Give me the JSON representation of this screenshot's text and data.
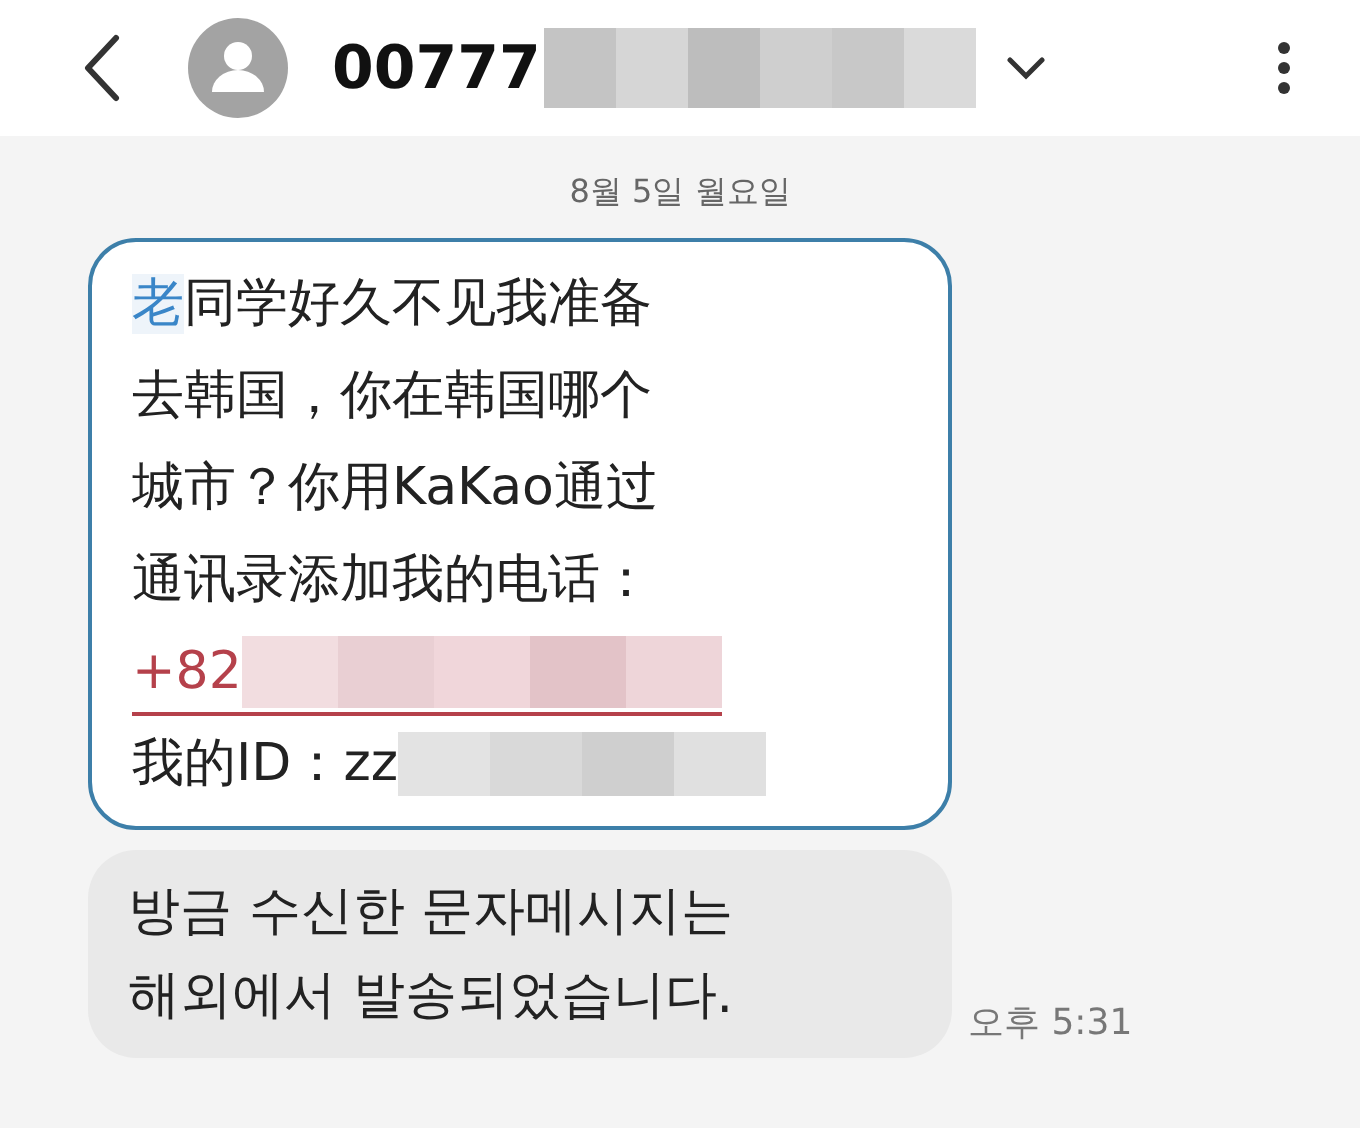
{
  "header": {
    "title": "00777"
  },
  "date": "8월 5일 월요일",
  "messages": [
    {
      "kind": "framed",
      "lines": [
        {
          "kind": "lead",
          "lead": "老",
          "text": "同学好久不见我准备"
        },
        {
          "kind": "plain",
          "text": "去韩国，你在韩国哪个"
        },
        {
          "kind": "plain",
          "text": "城市？你用KaKao通过"
        },
        {
          "kind": "plain",
          "text": "通讯录添加我的电话："
        },
        {
          "kind": "phone",
          "text": "+82"
        },
        {
          "kind": "id",
          "text": "我的ID：zz"
        }
      ]
    },
    {
      "kind": "notice",
      "lines": [
        {
          "kind": "plain",
          "text": "방금 수신한 문자메시지는"
        },
        {
          "kind": "plain",
          "text": "해외에서 발송되었습니다."
        }
      ],
      "time": "오후 5:31"
    }
  ]
}
